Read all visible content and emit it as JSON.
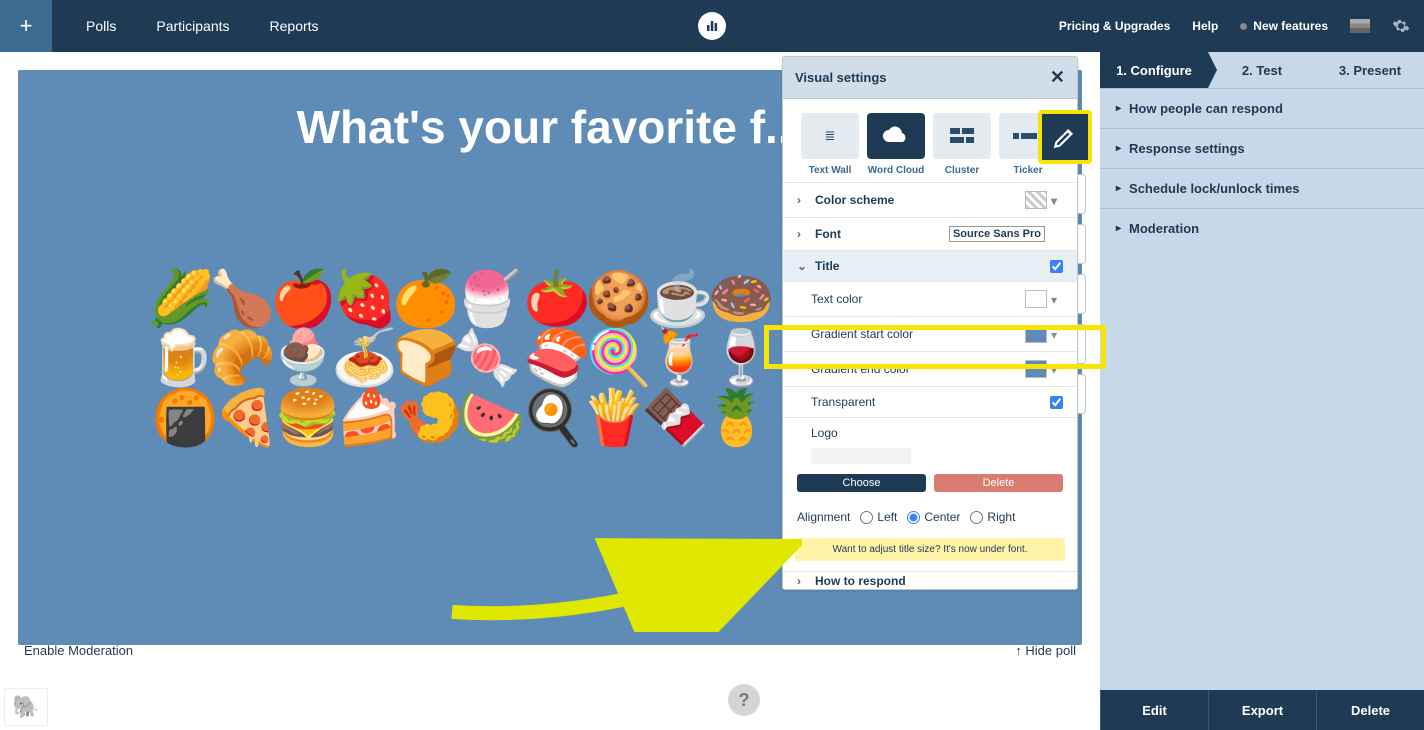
{
  "nav": {
    "plus": "+",
    "links": [
      "Polls",
      "Participants",
      "Reports"
    ],
    "pricing": "Pricing & Upgrades",
    "help": "Help",
    "new_features": "New features"
  },
  "poll": {
    "title": "What's your favorite f...",
    "enable_moderation": "Enable Moderation",
    "hide_poll": "↑ Hide poll",
    "emoji_sample": "🌽🍗🍎🍓🍊🍧\n🍅🍪☕🍩🍺🥐🍨🍝🍞🍬\n🍣🍭🍹🍷🍘🍕🍔🍰🍤🍉🍳🍟🍫🍍"
  },
  "vs": {
    "header": "Visual settings",
    "types": [
      {
        "label": "Text Wall",
        "icon": "≡"
      },
      {
        "label": "Word Cloud",
        "icon": "☁",
        "active": true
      },
      {
        "label": "Cluster",
        "icon": "▦"
      },
      {
        "label": "Ticker",
        "icon": "▭"
      }
    ],
    "color_scheme": "Color scheme",
    "font": "Font",
    "font_value": "Source Sans Pro",
    "title": "Title",
    "title_checked": true,
    "text_color": "Text color",
    "grad_start": "Gradient start color",
    "grad_end": "Gradient end color",
    "transparent": "Transparent",
    "transparent_checked": true,
    "logo": "Logo",
    "choose": "Choose",
    "delete": "Delete",
    "alignment": "Alignment",
    "align_left": "Left",
    "align_center": "Center",
    "align_right": "Right",
    "align_value": "center",
    "tip": "Want to adjust title size? It's now under font.",
    "how_respond": "How to respond",
    "colors": {
      "text": "#ffffff",
      "grad_start": "#5e8cb6",
      "grad_end": "#5e8cb6",
      "scheme_swatch": "#dddddd"
    }
  },
  "right": {
    "steps": [
      "1. Configure",
      "2. Test",
      "3. Present"
    ],
    "items": [
      "How people can respond",
      "Response settings",
      "Schedule lock/unlock times",
      "Moderation"
    ],
    "actions": [
      "Edit",
      "Export",
      "Delete"
    ]
  }
}
